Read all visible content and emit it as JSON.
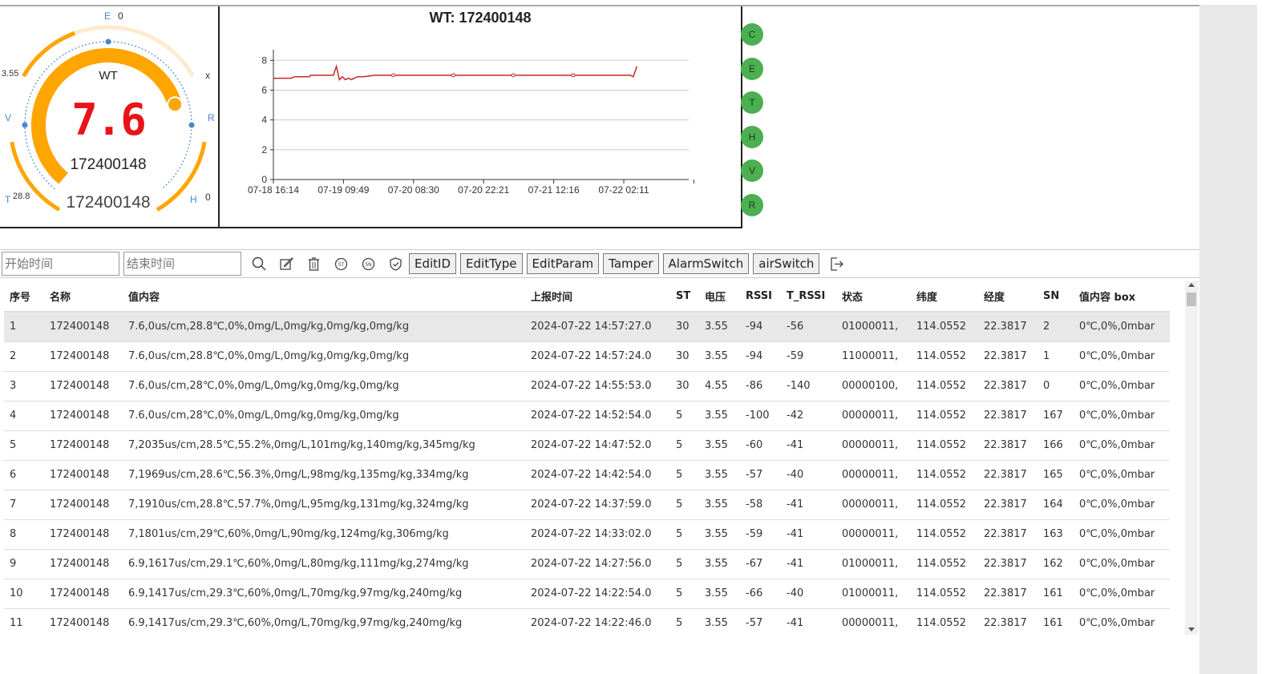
{
  "gauge": {
    "title": "WT",
    "value": "7.6",
    "sn": "172400148",
    "sn_bottom": "172400148",
    "label_top_letter": "E",
    "label_top_value": "0",
    "label_left_value": "3.55",
    "label_right_letter": "x",
    "label_v": "V",
    "label_r": "R",
    "label_t_letter": "T",
    "label_t_value": "28.8",
    "label_h_letter": "H",
    "label_h_value": "0",
    "fill_fraction": 0.76,
    "colors": {
      "main_arc": "#ffa500",
      "track_arc": "#fdebd0",
      "value": "#e8141a",
      "dots": "#4a86c9"
    }
  },
  "chart_data": {
    "type": "line",
    "title": "WT: 172400148",
    "x_ticks": [
      "07-18 16:14",
      "07-19 09:49",
      "07-20 08:30",
      "07-20 22:21",
      "07-21 12:16",
      "07-22 02:11"
    ],
    "y_ticks": [
      "0",
      "2",
      "4",
      "6",
      "8"
    ],
    "ylim": [
      0,
      8.5
    ],
    "grid": true,
    "series": [
      {
        "color": "#c62828",
        "x": [
          0,
          0.3,
          0.35,
          0.6,
          0.62,
          1.0,
          1.05,
          1.1,
          1.15,
          1.2,
          1.25,
          1.3,
          1.35,
          1.4,
          1.5,
          1.7,
          2.0,
          3.0,
          4.0,
          5.0,
          5.4,
          5.95,
          6.0,
          6.06
        ],
        "y": [
          6.8,
          6.8,
          6.9,
          6.9,
          7.0,
          7.0,
          7.6,
          6.7,
          6.9,
          6.7,
          6.8,
          6.7,
          6.8,
          6.9,
          6.9,
          7.0,
          7.0,
          7.0,
          7.0,
          7.0,
          7.0,
          7.0,
          6.9,
          7.6
        ]
      }
    ]
  },
  "side_buttons": [
    "C",
    "E",
    "T",
    "H",
    "V",
    "R"
  ],
  "toolbar": {
    "start_placeholder": "开始时间",
    "end_placeholder": "结束时间",
    "buttons": [
      "EditID",
      "EditType",
      "EditParam",
      "Tamper",
      "AlarmSwitch",
      "airSwitch"
    ]
  },
  "table": {
    "headers": [
      "序号",
      "名称",
      "值内容",
      "上报时间",
      "ST",
      "电压",
      "RSSI",
      "T_RSSI",
      "状态",
      "纬度",
      "经度",
      "SN",
      "值内容 box"
    ],
    "rows": [
      [
        "1",
        "172400148",
        "7.6,0us/cm,28.8℃,0%,0mg/L,0mg/kg,0mg/kg,0mg/kg",
        "2024-07-22 14:57:27.0",
        "30",
        "3.55",
        "-94",
        "-56",
        "01000011,",
        "114.0552",
        "22.3817",
        "2",
        "0℃,0%,0mbar"
      ],
      [
        "2",
        "172400148",
        "7.6,0us/cm,28.8℃,0%,0mg/L,0mg/kg,0mg/kg,0mg/kg",
        "2024-07-22 14:57:24.0",
        "30",
        "3.55",
        "-94",
        "-59",
        "11000011,",
        "114.0552",
        "22.3817",
        "1",
        "0℃,0%,0mbar"
      ],
      [
        "3",
        "172400148",
        "7.6,0us/cm,28℃,0%,0mg/L,0mg/kg,0mg/kg,0mg/kg",
        "2024-07-22 14:55:53.0",
        "30",
        "4.55",
        "-86",
        "-140",
        "00000100,",
        "114.0552",
        "22.3817",
        "0",
        "0℃,0%,0mbar"
      ],
      [
        "4",
        "172400148",
        "7.6,0us/cm,28℃,0%,0mg/L,0mg/kg,0mg/kg,0mg/kg",
        "2024-07-22 14:52:54.0",
        "5",
        "3.55",
        "-100",
        "-42",
        "00000011,",
        "114.0552",
        "22.3817",
        "167",
        "0℃,0%,0mbar"
      ],
      [
        "5",
        "172400148",
        "7,2035us/cm,28.5℃,55.2%,0mg/L,101mg/kg,140mg/kg,345mg/kg",
        "2024-07-22 14:47:52.0",
        "5",
        "3.55",
        "-60",
        "-41",
        "00000011,",
        "114.0552",
        "22.3817",
        "166",
        "0℃,0%,0mbar"
      ],
      [
        "6",
        "172400148",
        "7,1969us/cm,28.6℃,56.3%,0mg/L,98mg/kg,135mg/kg,334mg/kg",
        "2024-07-22 14:42:54.0",
        "5",
        "3.55",
        "-57",
        "-40",
        "00000011,",
        "114.0552",
        "22.3817",
        "165",
        "0℃,0%,0mbar"
      ],
      [
        "7",
        "172400148",
        "7,1910us/cm,28.8℃,57.7%,0mg/L,95mg/kg,131mg/kg,324mg/kg",
        "2024-07-22 14:37:59.0",
        "5",
        "3.55",
        "-58",
        "-41",
        "00000011,",
        "114.0552",
        "22.3817",
        "164",
        "0℃,0%,0mbar"
      ],
      [
        "8",
        "172400148",
        "7,1801us/cm,29℃,60%,0mg/L,90mg/kg,124mg/kg,306mg/kg",
        "2024-07-22 14:33:02.0",
        "5",
        "3.55",
        "-59",
        "-41",
        "00000011,",
        "114.0552",
        "22.3817",
        "163",
        "0℃,0%,0mbar"
      ],
      [
        "9",
        "172400148",
        "6.9,1617us/cm,29.1℃,60%,0mg/L,80mg/kg,111mg/kg,274mg/kg",
        "2024-07-22 14:27:56.0",
        "5",
        "3.55",
        "-67",
        "-41",
        "01000011,",
        "114.0552",
        "22.3817",
        "162",
        "0℃,0%,0mbar"
      ],
      [
        "10",
        "172400148",
        "6.9,1417us/cm,29.3℃,60%,0mg/L,70mg/kg,97mg/kg,240mg/kg",
        "2024-07-22 14:22:54.0",
        "5",
        "3.55",
        "-66",
        "-40",
        "01000011,",
        "114.0552",
        "22.3817",
        "161",
        "0℃,0%,0mbar"
      ],
      [
        "11",
        "172400148",
        "6.9,1417us/cm,29.3℃,60%,0mg/L,70mg/kg,97mg/kg,240mg/kg",
        "2024-07-22 14:22:46.0",
        "5",
        "3.55",
        "-57",
        "-41",
        "00000011,",
        "114.0552",
        "22.3817",
        "161",
        "0℃,0%,0mbar"
      ]
    ]
  }
}
